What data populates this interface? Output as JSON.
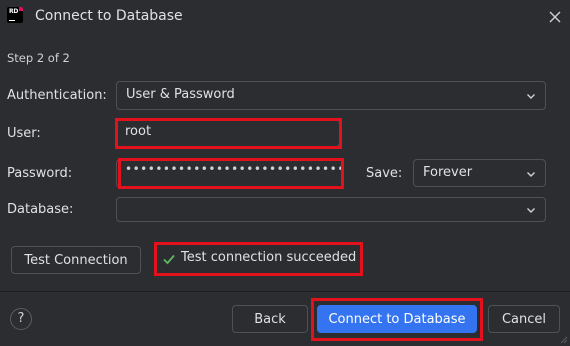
{
  "window": {
    "title": "Connect to Database",
    "app_logo_text": "RD"
  },
  "step_label": "Step 2 of 2",
  "authentication": {
    "label": "Authentication:",
    "value": "User & Password"
  },
  "user": {
    "label": "User:",
    "value": "root"
  },
  "password": {
    "label": "Password:",
    "masked_value": "•••••••••••••••••••••••••••••"
  },
  "save": {
    "label": "Save:",
    "value": "Forever"
  },
  "database": {
    "label": "Database:",
    "value": ""
  },
  "test_connection": {
    "button_label": "Test Connection",
    "status_message": "Test connection succeeded"
  },
  "footer": {
    "help_label": "?",
    "back_label": "Back",
    "connect_label": "Connect to Database",
    "cancel_label": "Cancel"
  },
  "colors": {
    "background": "#2b2d30",
    "primary_button": "#3574f0",
    "success_check": "#5fb865",
    "highlight": "#e3111b"
  }
}
